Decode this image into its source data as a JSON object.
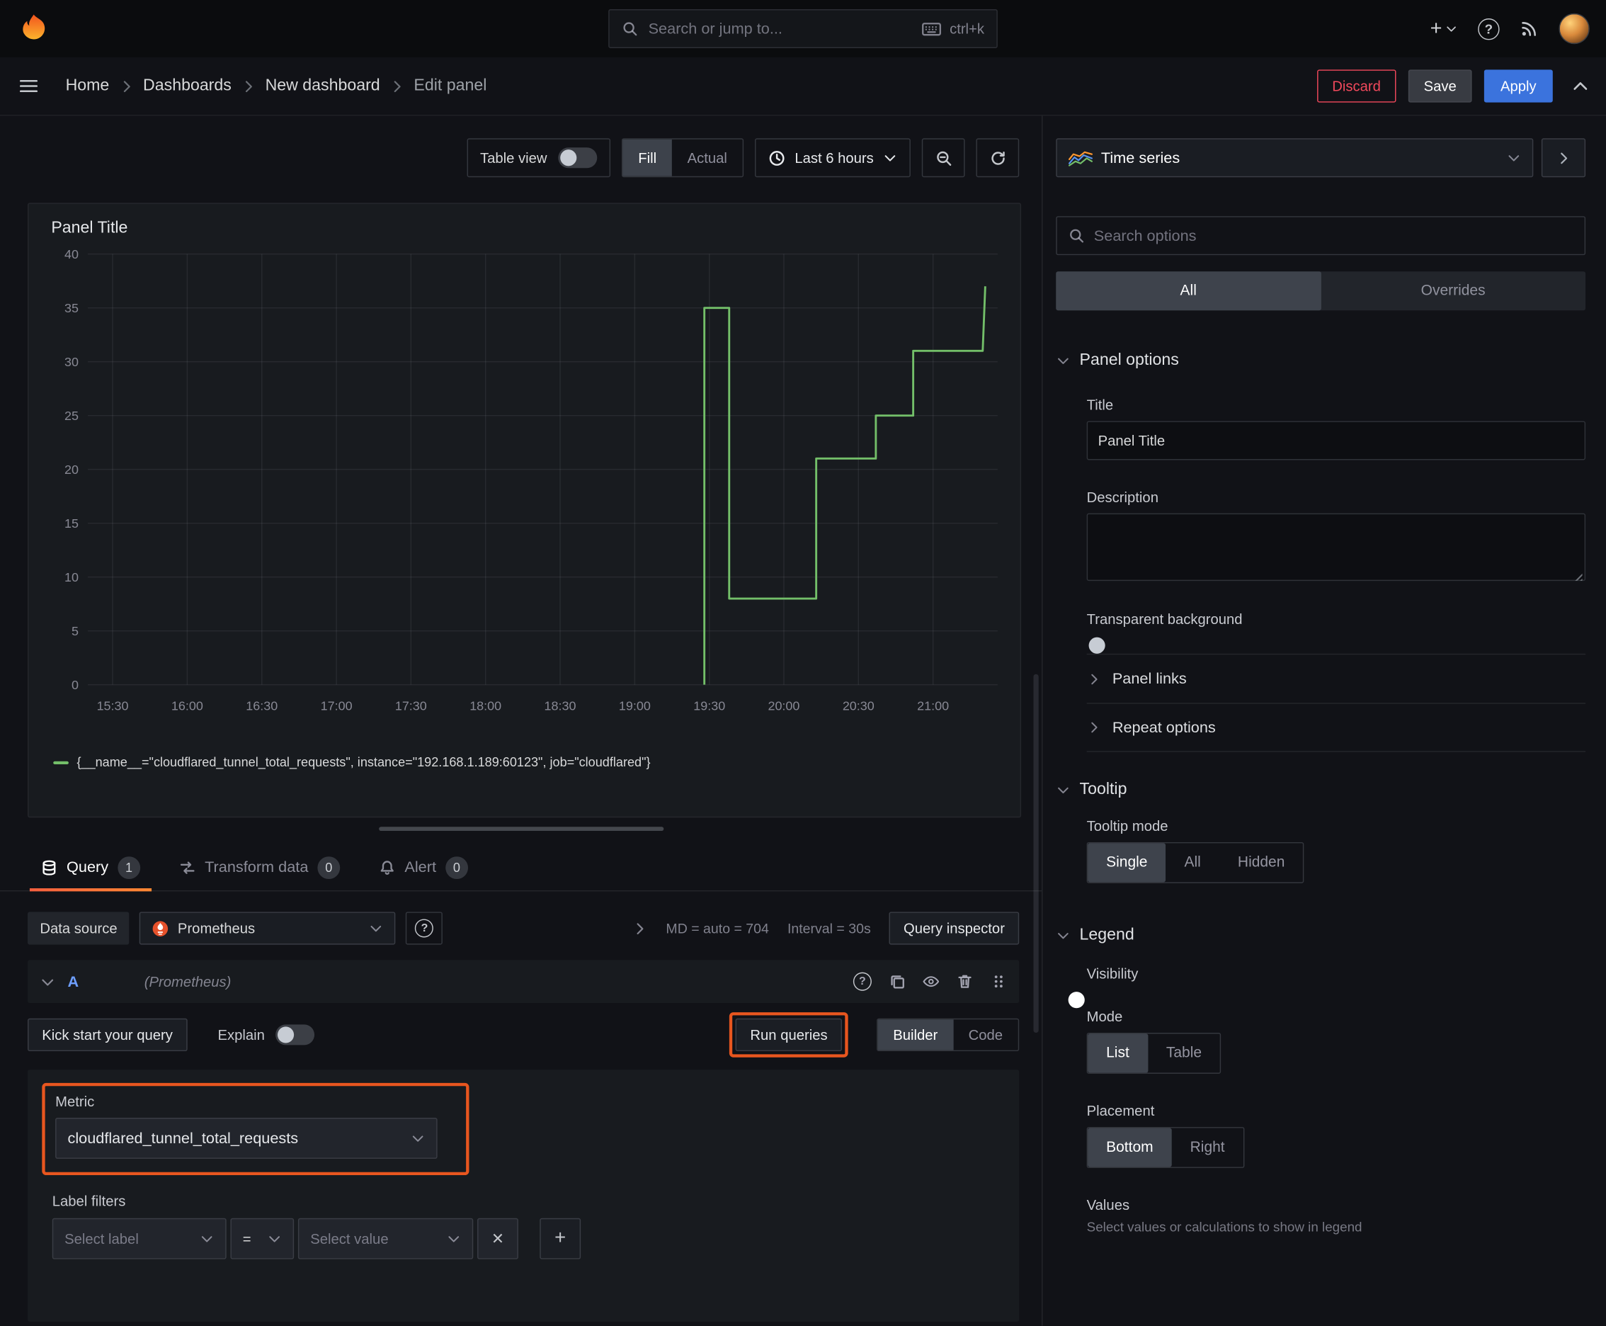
{
  "topbar": {
    "search_placeholder": "Search or jump to...",
    "search_shortcut": "ctrl+k"
  },
  "icons": {
    "plus": "+",
    "question": "?",
    "close": "✕"
  },
  "crumbs": {
    "items": [
      "Home",
      "Dashboards",
      "New dashboard",
      "Edit panel"
    ],
    "discard": "Discard",
    "save": "Save",
    "apply": "Apply"
  },
  "left_toolbar": {
    "table_view": "Table view",
    "fill": "Fill",
    "actual": "Actual",
    "time_range": "Last 6 hours"
  },
  "panel": {
    "title": "Panel Title",
    "legend_label": "{__name__=\"cloudflared_tunnel_total_requests\", instance=\"192.168.1.189:60123\", job=\"cloudflared\"}"
  },
  "tabs": [
    {
      "label": "Query",
      "count": "1"
    },
    {
      "label": "Transform data",
      "count": "0"
    },
    {
      "label": "Alert",
      "count": "0"
    }
  ],
  "query": {
    "datasource_label": "Data source",
    "datasource_name": "Prometheus",
    "md_stat": "MD = auto = 704",
    "interval_stat": "Interval = 30s",
    "inspector": "Query inspector",
    "ref_id": "A",
    "ref_ds": "(Prometheus)",
    "kickstart": "Kick start your query",
    "explain": "Explain",
    "run": "Run queries",
    "builder": "Builder",
    "code": "Code",
    "metric_label": "Metric",
    "metric_value": "cloudflared_tunnel_total_requests",
    "label_filters": "Label filters",
    "select_label": "Select label",
    "operator": "=",
    "select_value": "Select value"
  },
  "sidebar": {
    "viz": "Time series",
    "search_placeholder": "Search options",
    "tab_all": "All",
    "tab_overrides": "Overrides",
    "panel_options": {
      "heading": "Panel options",
      "title_label": "Title",
      "title_value": "Panel Title",
      "description_label": "Description",
      "transparent_label": "Transparent background"
    },
    "panel_links": "Panel links",
    "repeat_options": "Repeat options",
    "tooltip": {
      "heading": "Tooltip",
      "mode_label": "Tooltip mode",
      "options": [
        "Single",
        "All",
        "Hidden"
      ],
      "selected": "Single"
    },
    "legend": {
      "heading": "Legend",
      "visibility_label": "Visibility",
      "mode_label": "Mode",
      "mode_options": [
        "List",
        "Table"
      ],
      "mode_selected": "List",
      "placement_label": "Placement",
      "placement_options": [
        "Bottom",
        "Right"
      ],
      "placement_selected": "Bottom",
      "values_label": "Values",
      "values_desc": "Select values or calculations to show in legend"
    }
  },
  "colors": {
    "series_green": "#73bf69",
    "accent_blue": "#3b73dd",
    "highlight_orange": "#e8561f",
    "destructive_red": "#f2495c",
    "tab_underline_gradient": [
      "#f55f3e",
      "#ff8833"
    ]
  },
  "chart_data": {
    "type": "line",
    "line_interpolation": "step",
    "title": "Panel Title",
    "x_ticks": [
      "15:30",
      "16:00",
      "16:30",
      "17:00",
      "17:30",
      "18:00",
      "18:30",
      "19:00",
      "19:30",
      "20:00",
      "20:30",
      "21:00"
    ],
    "y_ticks": [
      0,
      5,
      10,
      15,
      20,
      25,
      30,
      35,
      40
    ],
    "ylim": [
      0,
      40
    ],
    "x_range_minutes": [
      920,
      1286
    ],
    "x_unit": "minutes after midnight",
    "grid": true,
    "legend_position": "bottom",
    "series": [
      {
        "name": "{__name__=\"cloudflared_tunnel_total_requests\", instance=\"192.168.1.189:60123\", job=\"cloudflared\"}",
        "color": "#73bf69",
        "points": [
          [
            1168,
            0
          ],
          [
            1168,
            35
          ],
          [
            1178,
            35
          ],
          [
            1178,
            8
          ],
          [
            1213,
            8
          ],
          [
            1213,
            21
          ],
          [
            1237,
            21
          ],
          [
            1237,
            25
          ],
          [
            1252,
            25
          ],
          [
            1252,
            31
          ],
          [
            1280,
            31
          ],
          [
            1281,
            37
          ]
        ]
      }
    ]
  }
}
